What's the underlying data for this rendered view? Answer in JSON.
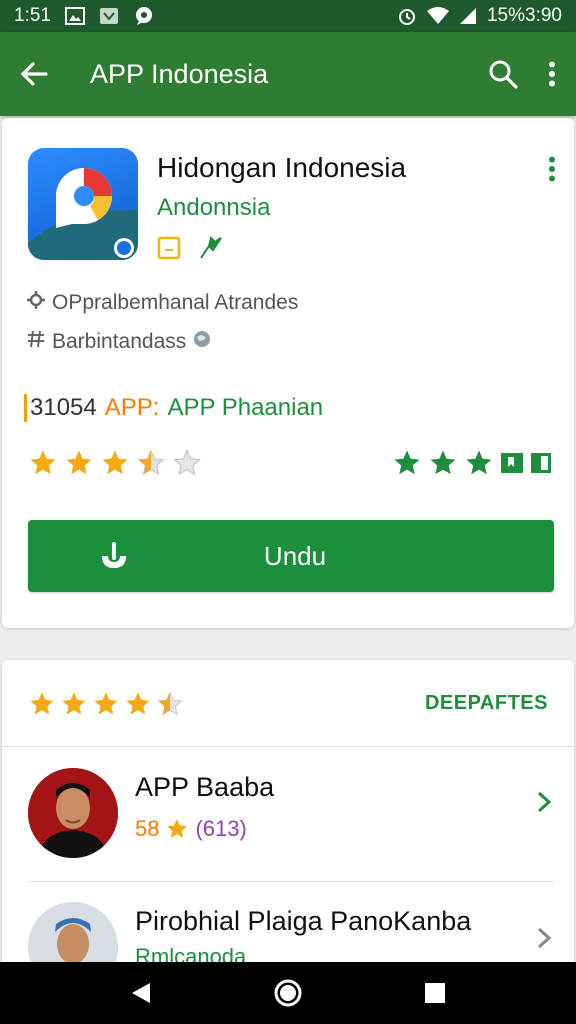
{
  "status_bar": {
    "time": "1:51",
    "battery_clock": "15%3:90"
  },
  "app_bar": {
    "title": "APP Indonesia",
    "icons": [
      "back-arrow-icon",
      "search-icon",
      "more-vert-icon"
    ]
  },
  "app": {
    "name": "Hidongan Indonesia",
    "developer": "Andonnsia",
    "meta_line_1": "OPpralbemhanal Atrandes",
    "meta_line_2": "Barbintandass",
    "price_code": "31054",
    "price_tag": "APP:",
    "price_kind": "APP Phaanian",
    "rating_stars": 3.5,
    "install_label": "Undu",
    "colors": {
      "accent": "#1c8f3c",
      "appbar": "#2e7d32",
      "star": "#f4a915"
    }
  },
  "reviews": {
    "rating_stars": 4.5,
    "see_all_label": "DEEPAFTES",
    "items": [
      {
        "name": "APP Baaba",
        "score": "58",
        "count": "(613)"
      },
      {
        "name": "Pirobhial Plaiga PanoKanba",
        "sub": "Rmlcanoda"
      }
    ]
  }
}
